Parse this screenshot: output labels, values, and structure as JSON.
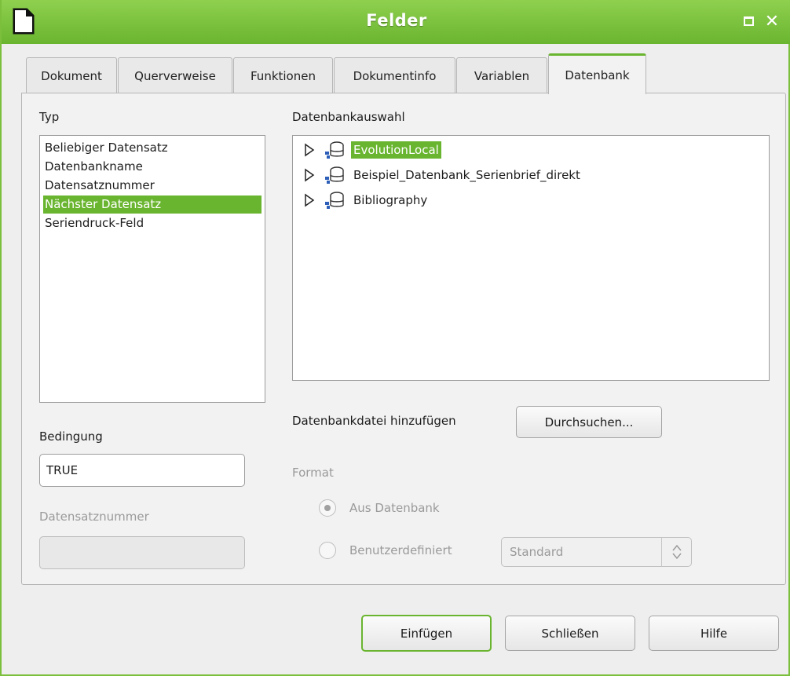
{
  "window": {
    "title": "Felder"
  },
  "tabs": [
    {
      "label": "Dokument",
      "active": false
    },
    {
      "label": "Querverweise",
      "active": false
    },
    {
      "label": "Funktionen",
      "active": false
    },
    {
      "label": "Dokumentinfo",
      "active": false
    },
    {
      "label": "Variablen",
      "active": false
    },
    {
      "label": "Datenbank",
      "active": true
    }
  ],
  "typ": {
    "label": "Typ",
    "items": [
      {
        "label": "Beliebiger Datensatz"
      },
      {
        "label": "Datenbankname"
      },
      {
        "label": "Datensatznummer"
      },
      {
        "label": "Nächster Datensatz",
        "selected": true
      },
      {
        "label": "Seriendruck-Feld"
      }
    ]
  },
  "datenbankauswahl": {
    "label": "Datenbankauswahl",
    "items": [
      {
        "label": "EvolutionLocal",
        "selected": true
      },
      {
        "label": "Beispiel_Datenbank_Serienbrief_direkt"
      },
      {
        "label": "Bibliography"
      }
    ]
  },
  "bedingung": {
    "label": "Bedingung",
    "value": "TRUE"
  },
  "datensatznummer": {
    "label": "Datensatznummer",
    "value": ""
  },
  "datenbankdatei": {
    "label": "Datenbankdatei hinzufügen",
    "button": "Durchsuchen..."
  },
  "format": {
    "label": "Format",
    "aus_datenbank": {
      "label": "Aus Datenbank",
      "checked": true
    },
    "benutzerdefiniert": {
      "label": "Benutzerdefiniert",
      "checked": false
    },
    "select_value": "Standard"
  },
  "buttons": {
    "insert": "Einfügen",
    "close": "Schließen",
    "help": "Hilfe"
  },
  "colors": {
    "accent": "#6ab530",
    "selection": "#6ab530",
    "window_bg": "#eeeeee"
  }
}
